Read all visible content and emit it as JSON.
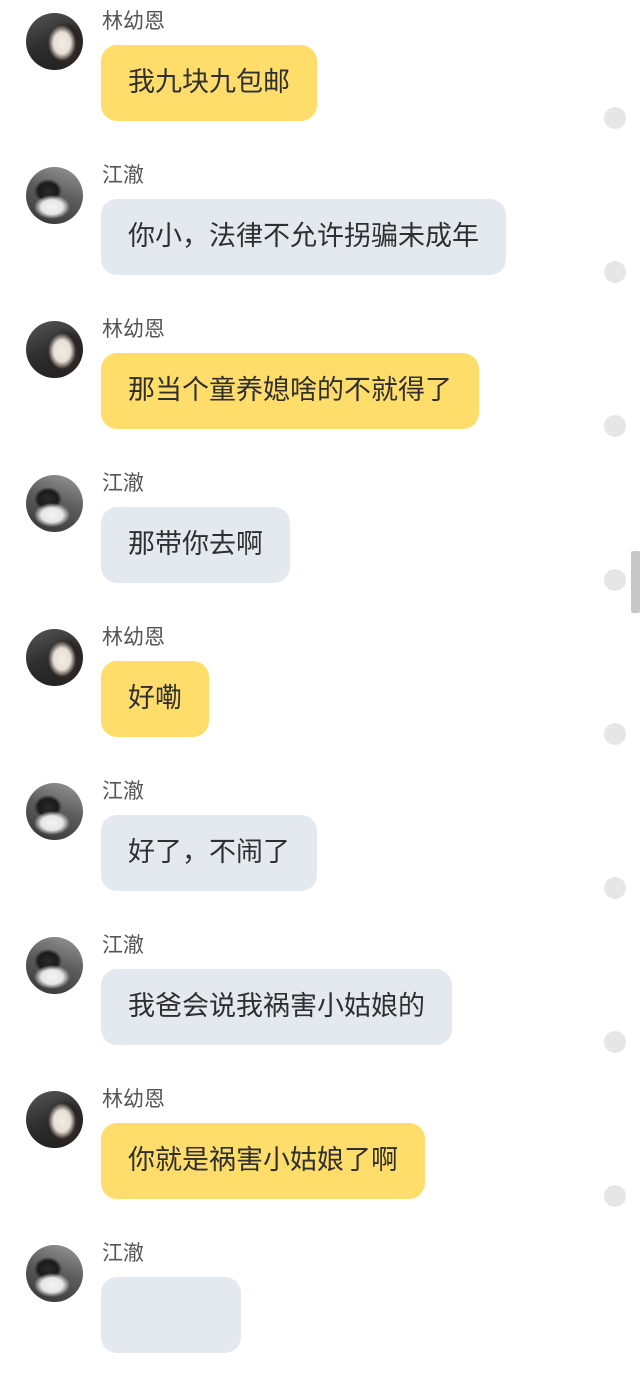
{
  "messages": [
    {
      "sender": "林幼恩",
      "text": "我九块九包邮",
      "bubble_color": "#ffdd6a"
    },
    {
      "sender": "江澈",
      "text": "你小，法律不允许拐骗未成年",
      "bubble_color": "#e4e9f0"
    },
    {
      "sender": "林幼恩",
      "text": "那当个童养媳啥的不就得了",
      "bubble_color": "#ffdd6a"
    },
    {
      "sender": "江澈",
      "text": "那带你去啊",
      "bubble_color": "#e4e9f0"
    },
    {
      "sender": "林幼恩",
      "text": "好嘞",
      "bubble_color": "#ffdd6a"
    },
    {
      "sender": "江澈",
      "text": "好了，不闹了",
      "bubble_color": "#e4e9f0"
    },
    {
      "sender": "江澈",
      "text": "我爸会说我祸害小姑娘的",
      "bubble_color": "#e4e9f0"
    },
    {
      "sender": "林幼恩",
      "text": "你就是祸害小姑娘了啊",
      "bubble_color": "#ffdd6a"
    },
    {
      "sender": "江澈",
      "text": "",
      "bubble_color": "#e4e9f0"
    }
  ]
}
